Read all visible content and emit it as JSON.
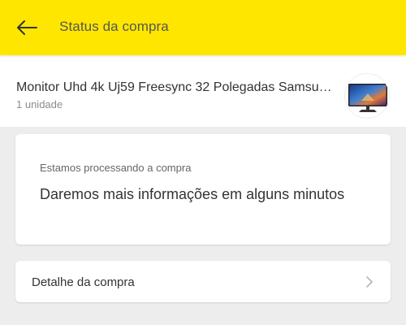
{
  "header": {
    "title": "Status da compra",
    "back_icon": "arrow-left-icon",
    "background": "#ffe600"
  },
  "product": {
    "name": "Monitor Uhd 4k Uj59 Freesync 32 Polegadas Samsung...",
    "quantity": "1 unidade",
    "thumbnail": "monitor-thumbnail"
  },
  "status": {
    "caption": "Estamos processando a compra",
    "message": "Daremos mais informações em alguns minutos"
  },
  "detail": {
    "label": "Detalhe da compra",
    "icon": "chevron-right-icon"
  }
}
